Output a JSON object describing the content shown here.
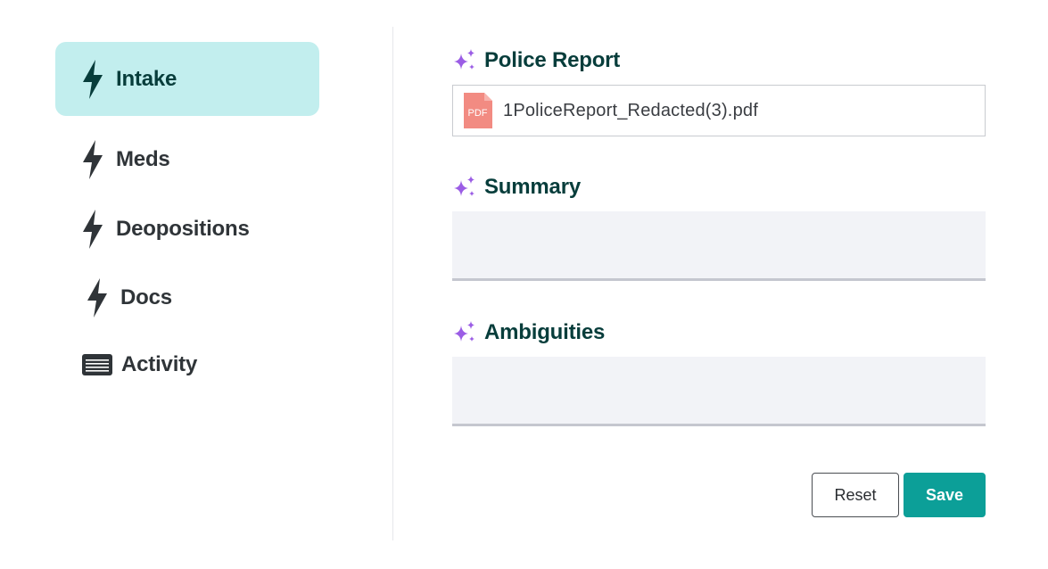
{
  "sidebar": {
    "items": [
      {
        "label": "Intake",
        "icon": "bolt-icon",
        "active": true
      },
      {
        "label": "Meds",
        "icon": "bolt-icon",
        "active": false
      },
      {
        "label": "Deopositions",
        "icon": "bolt-icon",
        "active": false
      },
      {
        "label": "Docs",
        "icon": "bolt-icon",
        "active": false
      },
      {
        "label": "Activity",
        "icon": "list-icon",
        "active": false
      }
    ]
  },
  "main": {
    "police_report": {
      "title": "Police Report",
      "icon": "sparkle-icon",
      "file": {
        "badge": "PDF",
        "name": "1PoliceReport_Redacted(3).pdf"
      }
    },
    "summary": {
      "title": "Summary",
      "icon": "sparkle-icon",
      "value": ""
    },
    "ambiguities": {
      "title": "Ambiguities",
      "icon": "sparkle-icon",
      "value": ""
    }
  },
  "actions": {
    "reset_label": "Reset",
    "save_label": "Save"
  },
  "colors": {
    "active_bg": "#c2eeee",
    "heading": "#073d3b",
    "accent": "#0c9f98",
    "sparkle": "#9b5de5",
    "pdf": "#f28b82"
  }
}
